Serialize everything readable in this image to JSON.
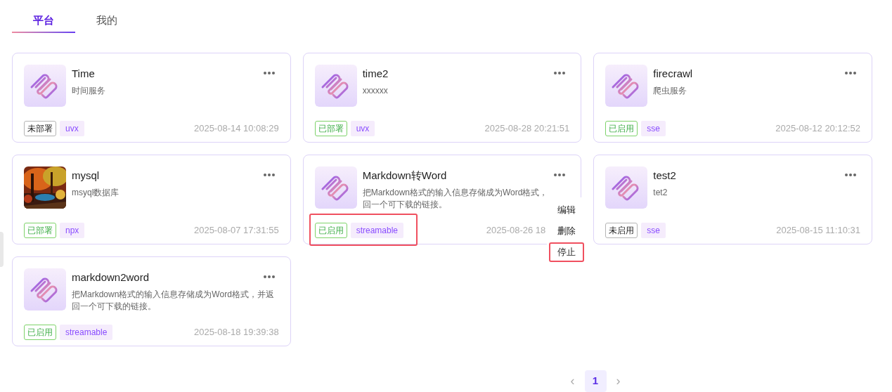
{
  "tabs": [
    {
      "label": "平台",
      "selected": true
    },
    {
      "label": "我的",
      "selected": false
    }
  ],
  "cards": [
    {
      "title": "Time",
      "description": [
        "时间服务"
      ],
      "status": {
        "label": "未部署",
        "kind": "inactive"
      },
      "type": "uvx",
      "time": "2025-08-14 10:08:29",
      "highlighted": false
    },
    {
      "title": "time2",
      "description": [
        "xxxxxx"
      ],
      "status": {
        "label": "已部署",
        "kind": "active"
      },
      "type": "uvx",
      "time": "2025-08-28 20:21:51",
      "highlighted": false
    },
    {
      "title": "firecrawl",
      "description": [
        "爬虫服务"
      ],
      "status": {
        "label": "已启用",
        "kind": "active"
      },
      "type": "sse",
      "time": "2025-08-12 20:12:52",
      "highlighted": false
    },
    {
      "title": "mysql",
      "description": [
        "msyql数据库"
      ],
      "status": {
        "label": "已部署",
        "kind": "active"
      },
      "type": "npx",
      "time": "2025-08-07 17:31:55",
      "kind": "picture",
      "highlighted": false
    },
    {
      "title": "Markdown转Word",
      "description": [
        "把Markdown格式的输入信息存储成为Word格式，",
        "回一个可下载的链接。"
      ],
      "status": {
        "label": "已启用",
        "kind": "active"
      },
      "type": "streamable",
      "time": "2025-08-26 18",
      "highlighted": true,
      "menu": [
        {
          "label": "编辑",
          "highlighted": false
        },
        {
          "label": "删除",
          "highlighted": false
        },
        {
          "label": "停止",
          "highlighted": true
        }
      ]
    },
    {
      "title": "test2",
      "description": [
        "tet2"
      ],
      "status": {
        "label": "未启用",
        "kind": "inactive"
      },
      "type": "sse",
      "time": "2025-08-15 11:10:31",
      "highlighted": false
    },
    {
      "title": "markdown2word",
      "description": [
        "把Markdown格式的输入信息存储成为Word格式，并返",
        "回一个可下载的链接。"
      ],
      "status": {
        "label": "已启用",
        "kind": "active"
      },
      "type": "streamable",
      "time": "2025-08-18 19:39:38",
      "highlighted": false
    }
  ],
  "pagination": {
    "prev": "‹",
    "next": "›",
    "pages": [
      {
        "label": "1",
        "selected": true
      }
    ]
  }
}
